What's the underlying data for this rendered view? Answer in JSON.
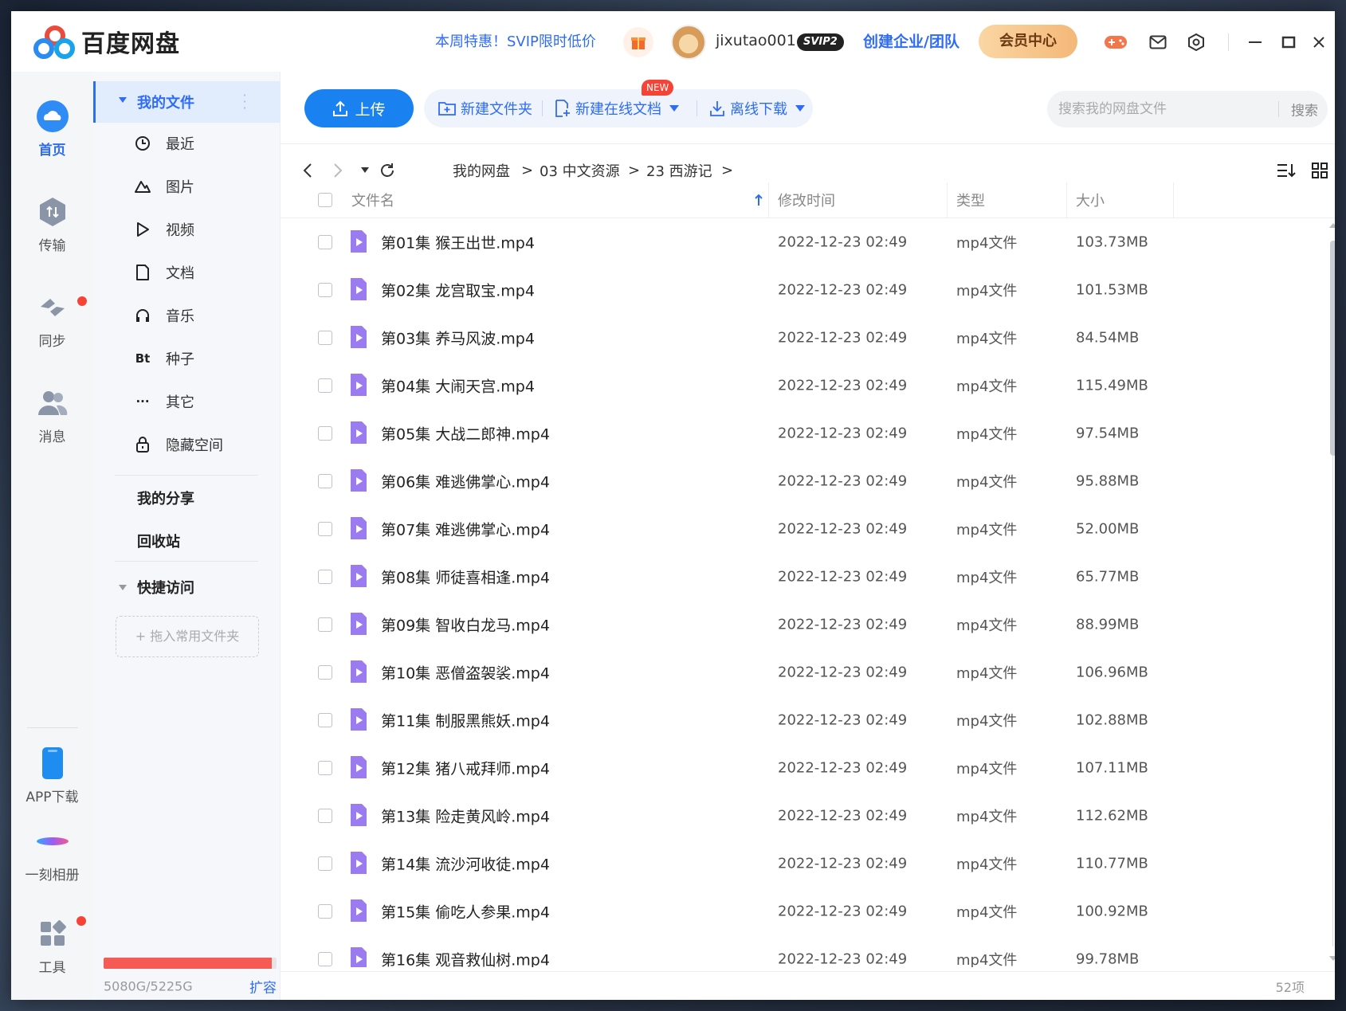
{
  "app": {
    "title": "百度网盘",
    "promo": "本周特惠！SVIP限时低价",
    "username": "jixutao001",
    "badge": "SVIP2",
    "enterprise": "创建企业/团队",
    "vip_center": "会员中心"
  },
  "colors": {
    "accent": "#2f6cf5",
    "upload_button": "#1a82f0",
    "storage_fill": "#f55a55",
    "video_icon": "#9b7cf0"
  },
  "leftnav": {
    "items": [
      {
        "label": "首页",
        "icon": "cloud-icon"
      },
      {
        "label": "传输",
        "icon": "transfer-icon"
      },
      {
        "label": "同步",
        "icon": "sync-icon"
      },
      {
        "label": "消息",
        "icon": "users-icon"
      },
      {
        "label": "APP下载",
        "icon": "phone-icon"
      },
      {
        "label": "一刻相册",
        "icon": "album-icon"
      },
      {
        "label": "工具",
        "icon": "apps-icon"
      }
    ]
  },
  "sidebar": {
    "my_files": "我的文件",
    "items": [
      {
        "label": "最近",
        "icon": "clock-icon"
      },
      {
        "label": "图片",
        "icon": "image-icon"
      },
      {
        "label": "视频",
        "icon": "play-icon"
      },
      {
        "label": "文档",
        "icon": "document-icon"
      },
      {
        "label": "音乐",
        "icon": "headphones-icon"
      },
      {
        "label": "种子",
        "icon_text": "Bt"
      },
      {
        "label": "其它",
        "icon_text": "···"
      },
      {
        "label": "隐藏空间",
        "icon": "lock-icon"
      }
    ],
    "my_share": "我的分享",
    "recycle": "回收站",
    "quick_access": "快捷访问",
    "drop_hint": "+ 拖入常用文件夹",
    "storage_text": "5080G/5225G",
    "storage_used_fraction": 0.972,
    "expand": "扩容"
  },
  "toolbar": {
    "upload": "上传",
    "new_folder": "新建文件夹",
    "new_online_doc": "新建在线文档",
    "new_badge": "NEW",
    "offline_download": "离线下载",
    "search_placeholder": "搜索我的网盘文件",
    "search_button": "搜索"
  },
  "breadcrumb": [
    "我的网盘",
    "03 中文资源",
    "23 西游记"
  ],
  "breadcrumb_sep": ">",
  "table": {
    "headers": {
      "name": "文件名",
      "time": "修改时间",
      "type": "类型",
      "size": "大小"
    },
    "rows": [
      {
        "name": "第01集 猴王出世.mp4",
        "time": "2022-12-23 02:49",
        "type": "mp4文件",
        "size": "103.73MB"
      },
      {
        "name": "第02集 龙宫取宝.mp4",
        "time": "2022-12-23 02:49",
        "type": "mp4文件",
        "size": "101.53MB"
      },
      {
        "name": "第03集 养马风波.mp4",
        "time": "2022-12-23 02:49",
        "type": "mp4文件",
        "size": "84.54MB"
      },
      {
        "name": "第04集 大闹天宫.mp4",
        "time": "2022-12-23 02:49",
        "type": "mp4文件",
        "size": "115.49MB"
      },
      {
        "name": "第05集 大战二郎神.mp4",
        "time": "2022-12-23 02:49",
        "type": "mp4文件",
        "size": "97.54MB"
      },
      {
        "name": "第06集 难逃佛掌心.mp4",
        "time": "2022-12-23 02:49",
        "type": "mp4文件",
        "size": "95.88MB"
      },
      {
        "name": "第07集 难逃佛掌心.mp4",
        "time": "2022-12-23 02:49",
        "type": "mp4文件",
        "size": "52.00MB"
      },
      {
        "name": "第08集 师徒喜相逢.mp4",
        "time": "2022-12-23 02:49",
        "type": "mp4文件",
        "size": "65.77MB"
      },
      {
        "name": "第09集 智收白龙马.mp4",
        "time": "2022-12-23 02:49",
        "type": "mp4文件",
        "size": "88.99MB"
      },
      {
        "name": "第10集 恶僧盗袈裟.mp4",
        "time": "2022-12-23 02:49",
        "type": "mp4文件",
        "size": "106.96MB"
      },
      {
        "name": "第11集 制服黑熊妖.mp4",
        "time": "2022-12-23 02:49",
        "type": "mp4文件",
        "size": "102.88MB"
      },
      {
        "name": "第12集 猪八戒拜师.mp4",
        "time": "2022-12-23 02:49",
        "type": "mp4文件",
        "size": "107.11MB"
      },
      {
        "name": "第13集 险走黄风岭.mp4",
        "time": "2022-12-23 02:49",
        "type": "mp4文件",
        "size": "112.62MB"
      },
      {
        "name": "第14集 流沙河收徒.mp4",
        "time": "2022-12-23 02:49",
        "type": "mp4文件",
        "size": "110.77MB"
      },
      {
        "name": "第15集 偷吃人参果.mp4",
        "time": "2022-12-23 02:49",
        "type": "mp4文件",
        "size": "100.92MB"
      },
      {
        "name": "第16集 观音救仙树.mp4",
        "time": "2022-12-23 02:49",
        "type": "mp4文件",
        "size": "99.78MB"
      }
    ]
  },
  "status": {
    "count": "52项"
  }
}
